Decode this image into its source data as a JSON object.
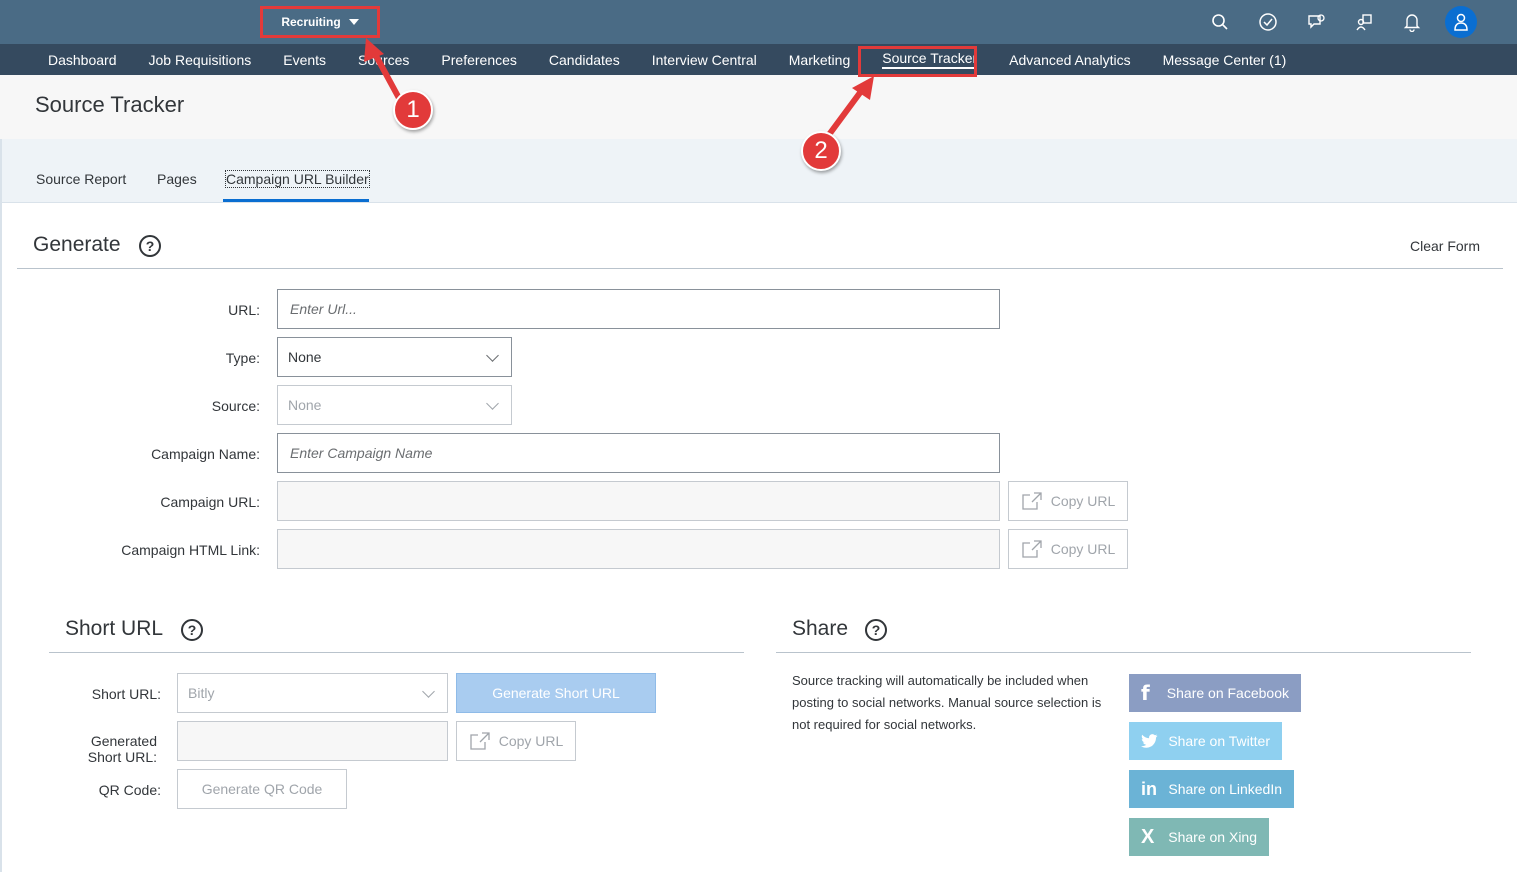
{
  "shell": {
    "module_label": "Recruiting",
    "icons": [
      "search-icon",
      "check-circle-icon",
      "feedback-icon",
      "people-icon",
      "bell-icon",
      "user-avatar-icon"
    ]
  },
  "nav": {
    "items": [
      {
        "label": "Dashboard"
      },
      {
        "label": "Job Requisitions"
      },
      {
        "label": "Events"
      },
      {
        "label": "Sources"
      },
      {
        "label": "Preferences"
      },
      {
        "label": "Candidates"
      },
      {
        "label": "Interview Central"
      },
      {
        "label": "Marketing"
      },
      {
        "label": "Source Tracker"
      },
      {
        "label": "Advanced Analytics"
      },
      {
        "label": "Message Center (1)"
      }
    ],
    "active": "Source Tracker"
  },
  "page": {
    "title": "Source Tracker"
  },
  "tabs": {
    "items": [
      {
        "label": "Source Report"
      },
      {
        "label": "Pages"
      },
      {
        "label": "Campaign URL Builder"
      }
    ],
    "active": "Campaign URL Builder"
  },
  "generate": {
    "title": "Generate",
    "help": "?",
    "clear_form": "Clear Form",
    "url_label": "URL:",
    "url_placeholder": "Enter Url...",
    "type_label": "Type:",
    "type_value": "None",
    "source_label": "Source:",
    "source_value": "None",
    "campaign_name_label": "Campaign Name:",
    "campaign_name_placeholder": "Enter Campaign Name",
    "campaign_url_label": "Campaign URL:",
    "campaign_html_label": "Campaign HTML Link:",
    "copy_url_label": "Copy URL"
  },
  "short_url": {
    "title": "Short URL",
    "help": "?",
    "short_url_label": "Short URL:",
    "short_url_value": "Bitly",
    "generate_short_label": "Generate Short URL",
    "generated_label_1": "Generated",
    "generated_label_2": "Short URL:",
    "copy_url_label": "Copy URL",
    "qr_label": "QR Code:",
    "generate_qr_label": "Generate QR Code"
  },
  "share": {
    "title": "Share",
    "help": "?",
    "description": "Source tracking will automatically be included when posting to social networks. Manual source selection is not required for social networks.",
    "buttons": [
      {
        "label": "Share on Facebook",
        "icon": "facebook-icon",
        "color": "#8b9dc3"
      },
      {
        "label": "Share on Twitter",
        "icon": "twitter-icon",
        "color": "#8fd0f0"
      },
      {
        "label": "Share on LinkedIn",
        "icon": "linkedin-icon",
        "color": "#6bb3d6"
      },
      {
        "label": "Share on Xing",
        "icon": "xing-icon",
        "color": "#7fb8b4"
      }
    ]
  },
  "annotations": {
    "badge_1": "1",
    "badge_2": "2",
    "highlight_color": "#e23a3a"
  }
}
